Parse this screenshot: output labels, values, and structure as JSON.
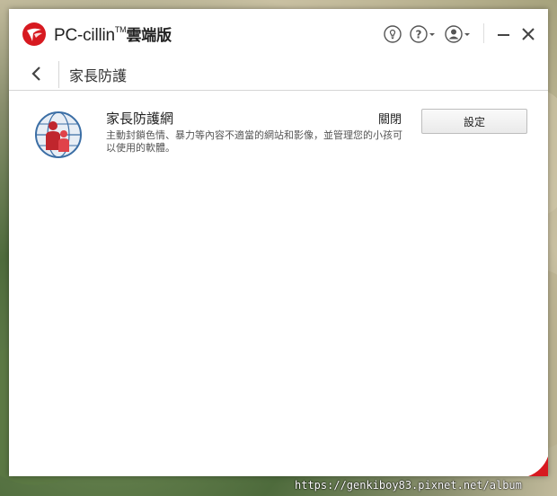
{
  "app": {
    "name": "PC-cillin",
    "trademark": "TM",
    "edition": "雲端版"
  },
  "titlebar": {
    "icons": [
      "lightbulb-icon",
      "help-icon",
      "account-icon",
      "minimize-icon",
      "close-icon"
    ]
  },
  "nav": {
    "title": "家長防護"
  },
  "feature": {
    "icon": "parental-controls-icon",
    "title": "家長防護網",
    "status": "關閉",
    "description": "主動封鎖色情、暴力等內容不適當的網站和影像，並管理您的小孩可以使用的軟體。",
    "button_label": "設定"
  },
  "watermark": "https://genkiboy83.pixnet.net/album",
  "colors": {
    "brand_red": "#d71920",
    "globe_blue": "#3b6ea5"
  }
}
